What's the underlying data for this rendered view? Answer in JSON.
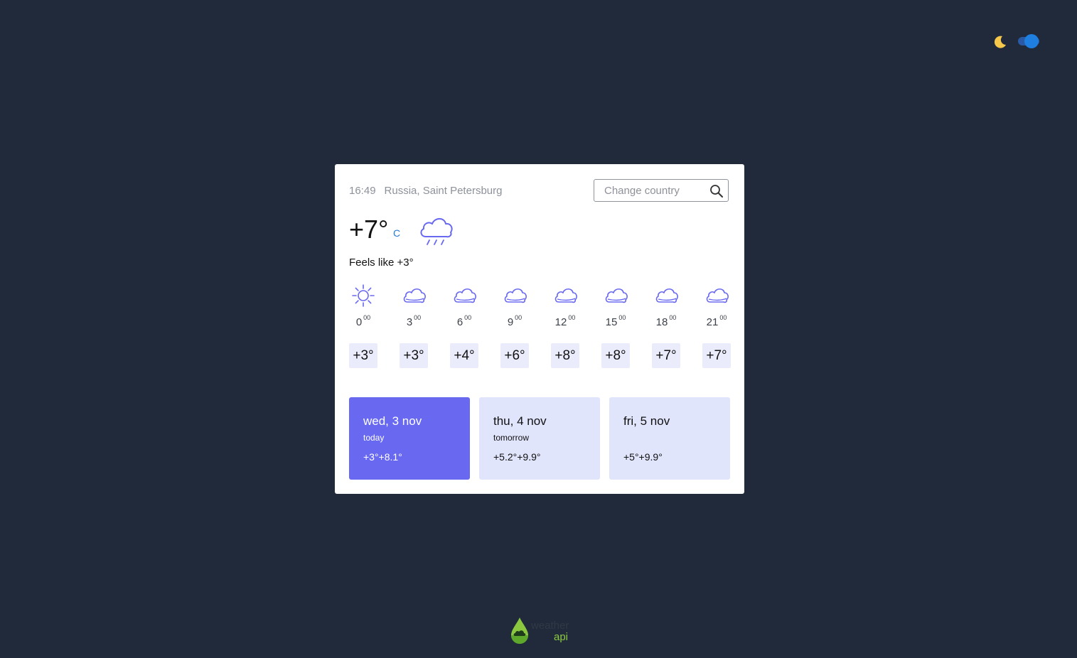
{
  "header": {
    "time": "16:49",
    "location": "Russia, Saint Petersburg"
  },
  "search": {
    "placeholder": "Change country",
    "value": ""
  },
  "current": {
    "temperature": "+7°",
    "unit": "C",
    "condition_icon": "rain-cloud-icon",
    "feels_like": "Feels like +3°"
  },
  "hourly": [
    {
      "hour": "0",
      "minutes": "00",
      "temp": "+3°",
      "icon": "sun-icon"
    },
    {
      "hour": "3",
      "minutes": "00",
      "temp": "+3°",
      "icon": "cloud-icon"
    },
    {
      "hour": "6",
      "minutes": "00",
      "temp": "+4°",
      "icon": "cloud-icon"
    },
    {
      "hour": "9",
      "minutes": "00",
      "temp": "+6°",
      "icon": "cloud-icon"
    },
    {
      "hour": "12",
      "minutes": "00",
      "temp": "+8°",
      "icon": "cloud-icon"
    },
    {
      "hour": "15",
      "minutes": "00",
      "temp": "+8°",
      "icon": "cloud-icon"
    },
    {
      "hour": "18",
      "minutes": "00",
      "temp": "+7°",
      "icon": "cloud-icon"
    },
    {
      "hour": "21",
      "minutes": "00",
      "temp": "+7°",
      "icon": "cloud-icon"
    }
  ],
  "days": [
    {
      "name": "wed, 3 nov",
      "sub": "today",
      "range": "+3°+8.1°",
      "active": true
    },
    {
      "name": "thu, 4 nov",
      "sub": "tomorrow",
      "range": "+5.2°+9.9°",
      "active": false
    },
    {
      "name": "fri, 5 nov",
      "sub": "",
      "range": "+5°+9.9°",
      "active": false
    }
  ],
  "theme": {
    "mode_icon": "moon-icon",
    "dark_mode": true
  },
  "footer": {
    "logo_line1": "weather",
    "logo_line2": "api"
  },
  "colors": {
    "background": "#212a3a",
    "accent": "#6868f0",
    "icon_stroke": "#6868f0",
    "day_card": "#e1e5fc",
    "hour_chip": "#eaecfc"
  }
}
